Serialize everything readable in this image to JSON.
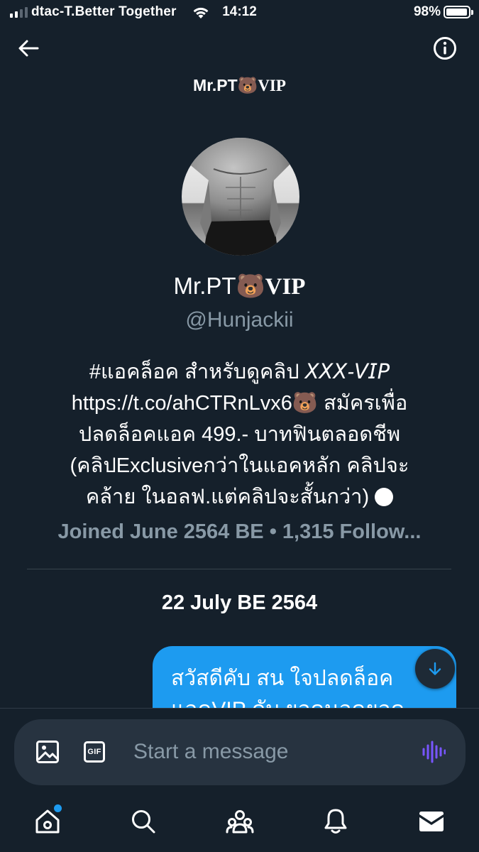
{
  "status_bar": {
    "carrier": "dtac-T.Better Together",
    "time": "14:12",
    "battery": "98%",
    "battery_level": 0.98,
    "signal_bars_active": 2,
    "signal_bars_total": 4
  },
  "header": {
    "title_name": "Mr.PT",
    "title_emoji": "🐻",
    "title_vip": "VIP",
    "back_icon": "arrow-left-icon",
    "info_icon": "info-circle-icon"
  },
  "profile": {
    "display_name": "Mr.PT",
    "display_emoji": "🐻",
    "display_vip": "VIP",
    "handle": "@Hunjackii",
    "bio_lines": [
      {
        "text": "#แอคล็อค สำหรับดูคลิป ",
        "emph": "𝘟𝘟𝘟-𝘝𝘐𝘗"
      },
      {
        "text": "https://t.co/ahCTRnLvx6🐻 สมัครเพื่อ"
      },
      {
        "text": "ปลดล็อคแอค 499.- บาทฟินตลอดชีพ"
      },
      {
        "text": "(คลิปExclusiveกว่าในแอคหลัก คลิปจะ"
      },
      {
        "text": "คล้าย ในอลฟ.แต่คลิปจะสั้นกว่า)"
      }
    ],
    "meta": "Joined June 2564 BE • 1,315 Follow..."
  },
  "conversation": {
    "date_label": "22 July BE 2564",
    "messages": [
      {
        "text_line1": "สวัสดีคับ สน ใจปลดล็อค",
        "text_line2": "แอคVIP คับ ยอดนอดยอด",
        "from_me": true
      }
    ],
    "scroll_icon": "arrow-down-icon"
  },
  "composer": {
    "placeholder": "Start a message",
    "gif_label": "GIF",
    "media_icon": "image-icon",
    "voice_icon": "voice-wave-icon"
  },
  "tab_bar": {
    "items": [
      "home-icon",
      "search-icon",
      "communities-icon",
      "notifications-icon",
      "messages-icon"
    ],
    "home_has_badge": true
  },
  "colors": {
    "background": "#15202b",
    "accent": "#1d9bf0",
    "secondary_text": "#8899a6",
    "composer_bg": "#273340",
    "voice_icon": "#7856ff"
  }
}
